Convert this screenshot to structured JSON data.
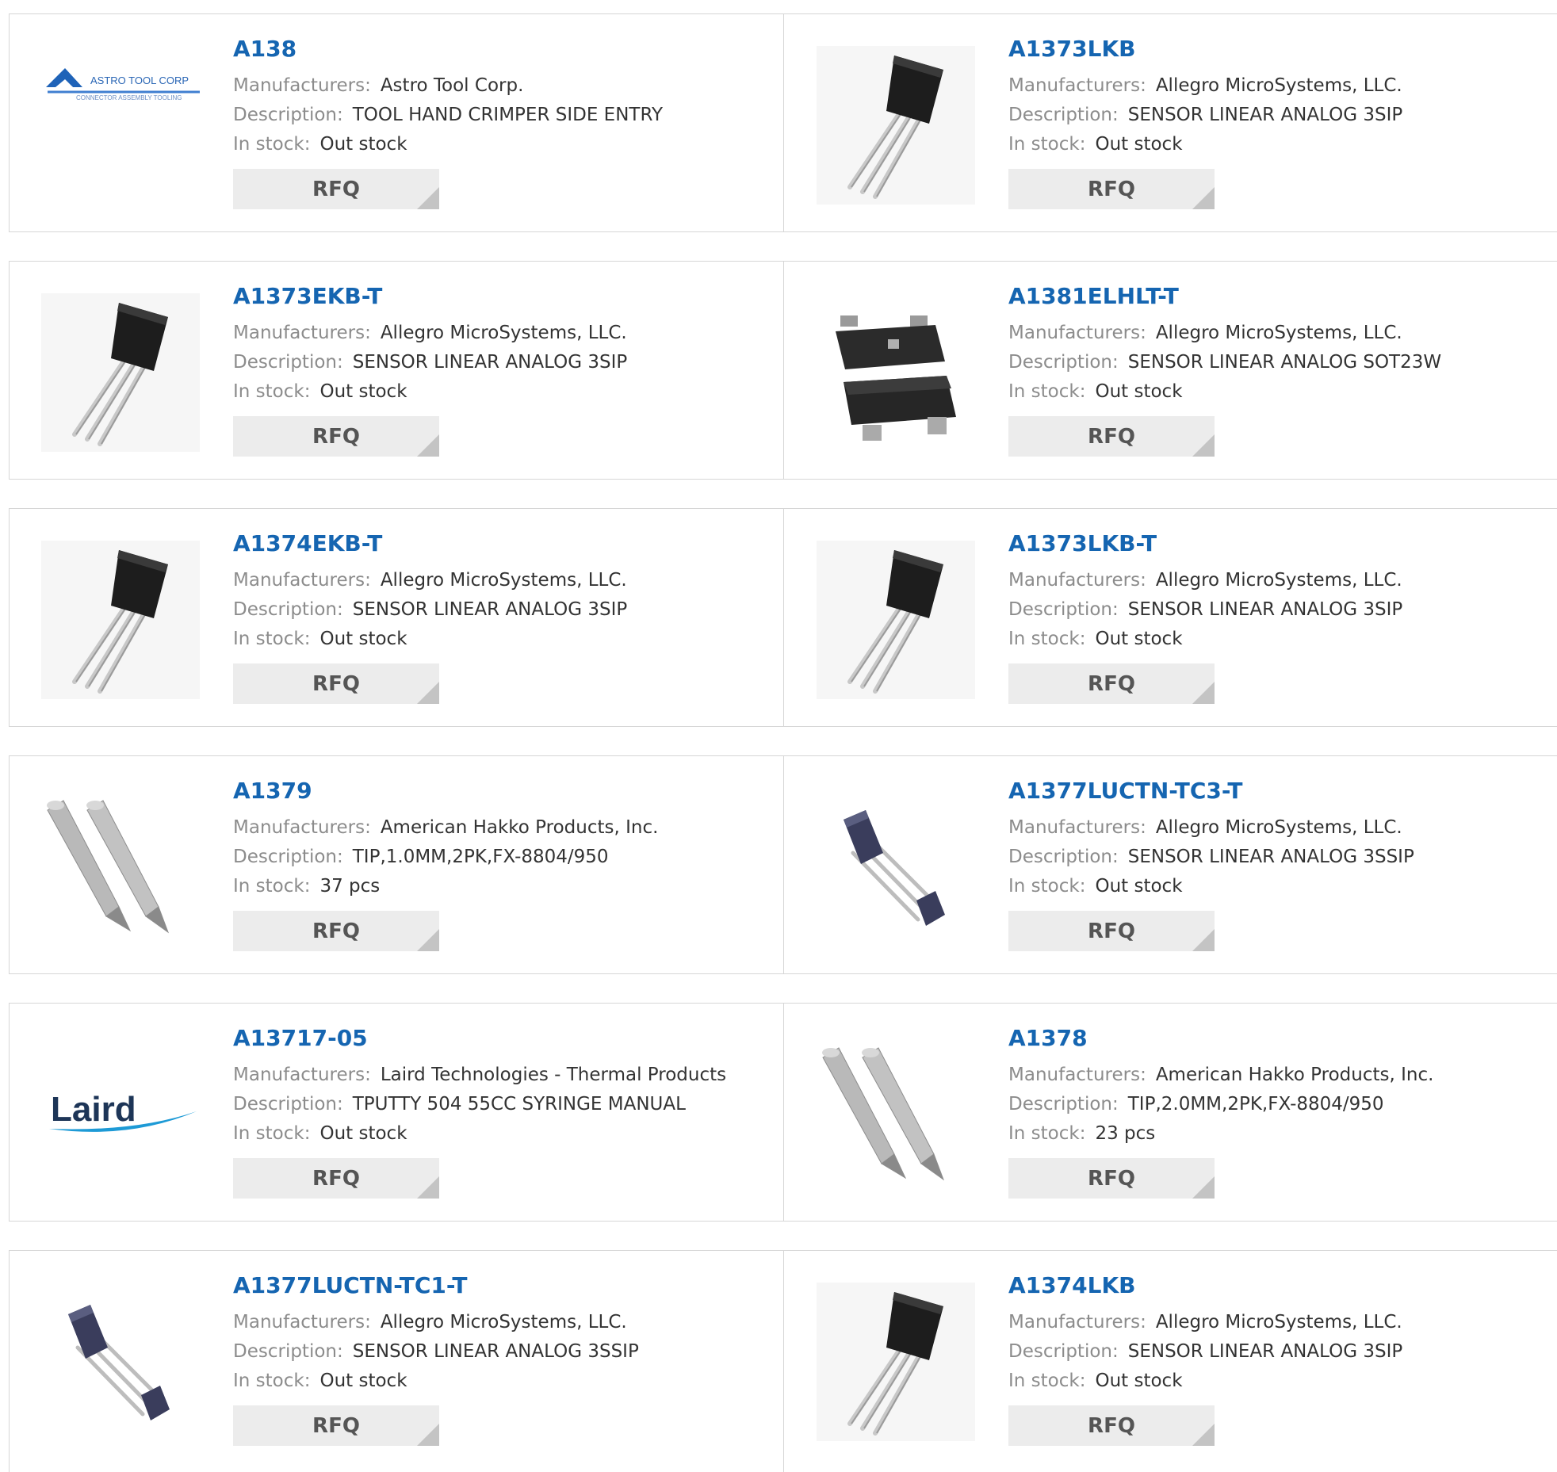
{
  "labels": {
    "manufacturers": "Manufacturers:",
    "description": "Description:",
    "in_stock": "In stock:",
    "rfq": "RFQ"
  },
  "colors": {
    "part_number": "#1565b1",
    "label": "#8c8c8c",
    "value": "#333333",
    "button_bg": "#ececec"
  },
  "products": [
    {
      "part": "A138",
      "manufacturer": "Astro Tool Corp.",
      "description": "TOOL HAND CRIMPER SIDE ENTRY",
      "stock": "Out stock",
      "image": "astro-tool-corp-logo",
      "logo_text_1": "ASTRO TOOL CORP",
      "logo_text_2": "CONNECTOR ASSEMBLY TOOLING"
    },
    {
      "part": "A1373LKB",
      "manufacturer": "Allegro MicroSystems, LLC.",
      "description": "SENSOR LINEAR ANALOG 3SIP",
      "stock": "Out stock",
      "image": "3sip-sensor-image"
    },
    {
      "part": "A1373EKB-T",
      "manufacturer": "Allegro MicroSystems, LLC.",
      "description": "SENSOR LINEAR ANALOG 3SIP",
      "stock": "Out stock",
      "image": "3sip-sensor-image"
    },
    {
      "part": "A1381ELHLT-T",
      "manufacturer": "Allegro MicroSystems, LLC.",
      "description": "SENSOR LINEAR ANALOG SOT23W",
      "stock": "Out stock",
      "image": "sot23w-package-image"
    },
    {
      "part": "A1374EKB-T",
      "manufacturer": "Allegro MicroSystems, LLC.",
      "description": "SENSOR LINEAR ANALOG 3SIP",
      "stock": "Out stock",
      "image": "3sip-sensor-image"
    },
    {
      "part": "A1373LKB-T",
      "manufacturer": "Allegro MicroSystems, LLC.",
      "description": "SENSOR LINEAR ANALOG 3SIP",
      "stock": "Out stock",
      "image": "3sip-sensor-image"
    },
    {
      "part": "A1379",
      "manufacturer": "American Hakko Products, Inc.",
      "description": "TIP,1.0MM,2PK,FX-8804/950",
      "stock": "37 pcs",
      "image": "solder-tips-image"
    },
    {
      "part": "A1377LUCTN-TC3-T",
      "manufacturer": "Allegro MicroSystems, LLC.",
      "description": "SENSOR LINEAR ANALOG 3SSIP",
      "stock": "Out stock",
      "image": "3ssip-sensor-image"
    },
    {
      "part": "A13717-05",
      "manufacturer": "Laird Technologies - Thermal Products",
      "description": "TPUTTY 504 55CC SYRINGE MANUAL",
      "stock": "Out stock",
      "image": "laird-logo",
      "logo_text_1": "Laird"
    },
    {
      "part": "A1378",
      "manufacturer": "American Hakko Products, Inc.",
      "description": "TIP,2.0MM,2PK,FX-8804/950",
      "stock": "23 pcs",
      "image": "solder-tips-image"
    },
    {
      "part": "A1377LUCTN-TC1-T",
      "manufacturer": "Allegro MicroSystems, LLC.",
      "description": "SENSOR LINEAR ANALOG 3SSIP",
      "stock": "Out stock",
      "image": "3ssip-sensor-image"
    },
    {
      "part": "A1374LKB",
      "manufacturer": "Allegro MicroSystems, LLC.",
      "description": "SENSOR LINEAR ANALOG 3SIP",
      "stock": "Out stock",
      "image": "3sip-sensor-image"
    }
  ]
}
